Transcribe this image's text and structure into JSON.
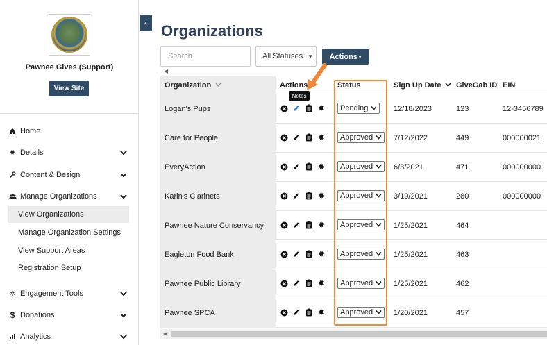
{
  "sidebar": {
    "site_name": "Pawnee Gives (Support)",
    "view_site_label": "View Site",
    "collapse_glyph": "‹",
    "nav": [
      {
        "label": "Home",
        "icon": "home-icon"
      },
      {
        "label": "Details",
        "icon": "gear-icon"
      },
      {
        "label": "Content & Design",
        "icon": "wrench-icon"
      },
      {
        "label": "Manage Organizations",
        "icon": "users-icon"
      },
      {
        "label": "Engagement Tools",
        "icon": "tools-icon"
      },
      {
        "label": "Donations",
        "icon": "dollar-icon"
      },
      {
        "label": "Analytics",
        "icon": "chart-icon"
      }
    ],
    "sub_items": [
      {
        "label": "View Organizations",
        "active": true
      },
      {
        "label": "Manage Organization Settings",
        "active": false
      },
      {
        "label": "View Support Areas",
        "active": false
      },
      {
        "label": "Registration Setup",
        "active": false
      }
    ]
  },
  "main": {
    "title": "Organizations",
    "search_placeholder": "Search",
    "status_filter": "All Statuses",
    "actions_label": "Actions",
    "tooltip": "Notes"
  },
  "table": {
    "headers": {
      "organization": "Organization",
      "actions": "Actions",
      "status": "Status",
      "signup": "Sign Up Date",
      "givegab_id": "GiveGab ID",
      "ein": "EIN"
    },
    "rows": [
      {
        "org": "Logan's Pups",
        "status": "Pending",
        "date": "12/18/2023",
        "id": "123",
        "ein": "12-3456789"
      },
      {
        "org": "Care for People",
        "status": "Approved",
        "date": "7/12/2022",
        "id": "449",
        "ein": "000000021"
      },
      {
        "org": "EveryAction",
        "status": "Approved",
        "date": "6/3/2021",
        "id": "471",
        "ein": "000000000"
      },
      {
        "org": "Karin's Clarinets",
        "status": "Approved",
        "date": "3/19/2021",
        "id": "280",
        "ein": "000000000"
      },
      {
        "org": "Pawnee Nature Conservancy",
        "status": "Approved",
        "date": "1/25/2021",
        "id": "464",
        "ein": ""
      },
      {
        "org": "Eagleton Food Bank",
        "status": "Approved",
        "date": "1/25/2021",
        "id": "463",
        "ein": ""
      },
      {
        "org": "Pawnee Public Library",
        "status": "Approved",
        "date": "1/25/2021",
        "id": "462",
        "ein": ""
      },
      {
        "org": "Pawnee SPCA",
        "status": "Approved",
        "date": "1/20/2021",
        "id": "457",
        "ein": ""
      }
    ]
  },
  "colors": {
    "brand_navy": "#2f4b66",
    "title": "#2f4058",
    "highlight": "#f08a3a",
    "edit_active": "#2a7fd4"
  }
}
